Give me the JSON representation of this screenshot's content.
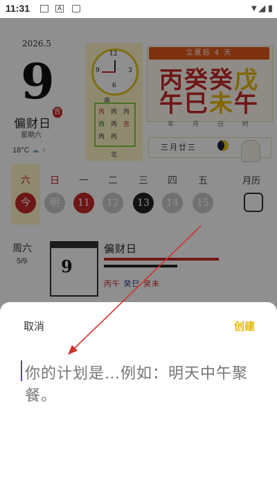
{
  "status": {
    "time": "11:31"
  },
  "calendar": {
    "year_month": "2026.5",
    "day": "9",
    "luck": "偏财日",
    "luck_badge": "吉",
    "weekday": "星期六",
    "temperature": "18°C",
    "clock": {
      "n12": "12",
      "n3": "3",
      "n6": "6",
      "n9": "9"
    },
    "grid": {
      "top": "南",
      "bottom": "北",
      "cells": [
        "丙",
        "丙",
        "丙",
        "西",
        "丙",
        "吉",
        "丙",
        "丙"
      ]
    },
    "lunar_banner": "立夏后 4 天",
    "ganzhi": [
      {
        "top": "丙",
        "bottom": "午",
        "label": "年",
        "color": "#c62828"
      },
      {
        "top": "癸",
        "bottom": "巳",
        "label": "月",
        "color": "#c62828"
      },
      {
        "top": "癸",
        "bottom": "未",
        "label": "日",
        "color": "#c62828",
        "bottom_color": "#e6b800"
      },
      {
        "top": "戊",
        "bottom": "午",
        "label": "时",
        "color": "#e6b800",
        "bottom_color": "#c62828"
      }
    ],
    "lunar_date": "三月廿三",
    "week_labels": [
      "六",
      "日",
      "一",
      "二",
      "三",
      "四",
      "五"
    ],
    "week_days": [
      "今",
      "明",
      "11",
      "12",
      "13",
      "14",
      "15"
    ],
    "month_calendar": "月历",
    "day_card": {
      "weekday": "周六",
      "date": "5/9",
      "day": "9",
      "title": "偏财日",
      "gz1": "丙午",
      "gz2": "癸巳",
      "gz3": "癸未"
    }
  },
  "sheet": {
    "cancel": "取消",
    "create": "创建",
    "placeholder": "你的计划是…例如：明天中午聚餐。"
  },
  "colors": {
    "accent": "#e6b800",
    "red": "#c62828",
    "arrow": "#d0312d"
  }
}
